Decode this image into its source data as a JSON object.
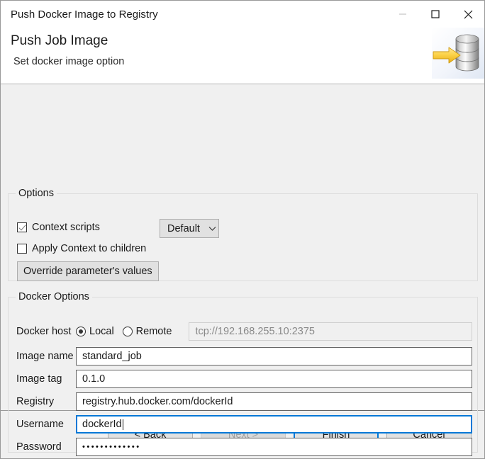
{
  "window": {
    "title": "Push Docker Image to Registry",
    "controls": {
      "minimize": "minimize-icon",
      "maximize": "maximize-icon",
      "close": "close-icon"
    }
  },
  "header": {
    "title": "Push Job Image",
    "subtitle": "Set docker image option",
    "icon": "database-push-icon"
  },
  "options_group": {
    "legend": "Options",
    "context_scripts": {
      "label": "Context scripts",
      "checked": true
    },
    "context_preset": {
      "value": "Default",
      "chevron": "chevron-down-icon"
    },
    "apply_context_children": {
      "label": "Apply Context to children",
      "checked": false
    },
    "override_button": {
      "label": "Override parameter's values"
    }
  },
  "docker_group": {
    "legend": "Docker Options",
    "host": {
      "label": "Docker host",
      "local": "Local",
      "remote": "Remote",
      "selected": "Local",
      "url_placeholder": "tcp://192.168.255.10:2375",
      "url_value": ""
    },
    "image_name": {
      "label": "Image name",
      "value": "standard_job"
    },
    "image_tag": {
      "label": "Image tag",
      "value": "0.1.0"
    },
    "registry": {
      "label": "Registry",
      "value": "registry.hub.docker.com/dockerId"
    },
    "username": {
      "label": "Username",
      "value": "dockerId",
      "focused": true
    },
    "password": {
      "label": "Password",
      "value": "•••••••••••••"
    }
  },
  "footer": {
    "back": "< Back",
    "next": "Next >",
    "finish": "Finish",
    "cancel": "Cancel"
  },
  "colors": {
    "accent": "#0078d7",
    "window_bg": "#f0f0f0",
    "header_bg": "#ffffff"
  }
}
